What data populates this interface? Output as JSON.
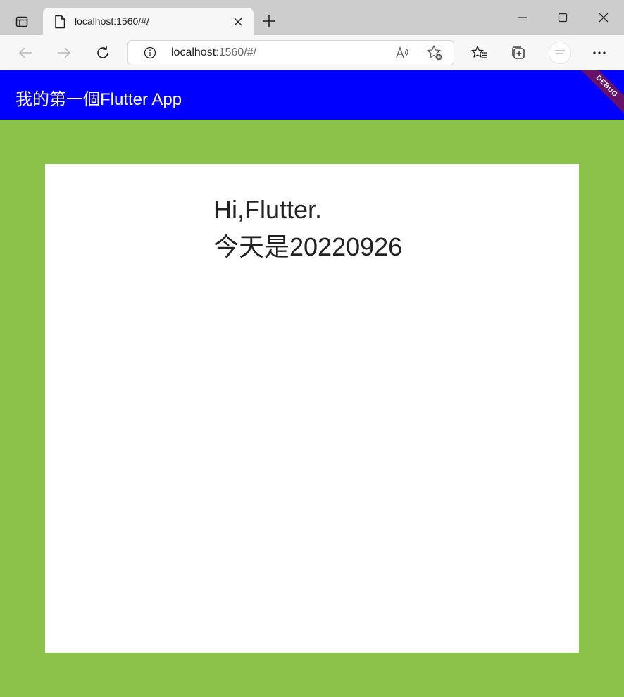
{
  "browser": {
    "tab": {
      "title": "localhost:1560/#/"
    },
    "address": {
      "host": "localhost",
      "rest": ":1560/#/"
    }
  },
  "app": {
    "title": "我的第一個Flutter App",
    "debug_banner": "DEBUG",
    "greeting_line1": "Hi,Flutter.",
    "greeting_line2": "今天是20220926",
    "colors": {
      "appbar": "#0000ff",
      "background": "#8bc34a",
      "card": "#ffffff"
    }
  }
}
